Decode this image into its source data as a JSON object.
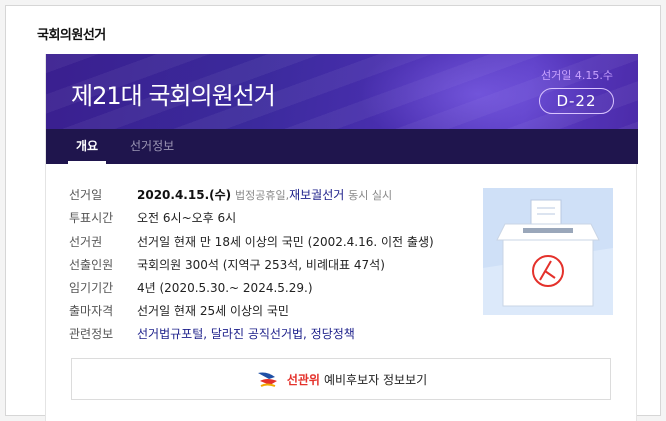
{
  "section_title": "국회의원선거",
  "banner": {
    "title": "제21대 국회의원선거",
    "election_date": "선거일 4.15.수",
    "dday": "D-22"
  },
  "tabs": [
    {
      "label": "개요",
      "active": true
    },
    {
      "label": "선거정보",
      "active": false
    }
  ],
  "info": {
    "election_day": {
      "label": "선거일",
      "date": "2020.4.15.(수)",
      "holiday": "법정공휴일,",
      "also": "재보궐선거",
      "suffix": "동시 실시"
    },
    "voting_hours": {
      "label": "투표시간",
      "value": "오전 6시~오후 6시"
    },
    "suffrage": {
      "label": "선거권",
      "value": "선거일 현재 만 18세 이상의 국민 (2002.4.16. 이전 출생)"
    },
    "seats": {
      "label": "선출인원",
      "value": "국회의원 300석 (지역구 253석, 비례대표 47석)"
    },
    "term": {
      "label": "임기기간",
      "value": "4년 (2020.5.30.~ 2024.5.29.)"
    },
    "eligibility": {
      "label": "출마자격",
      "value": "선거일 현재 25세 이상의 국민"
    },
    "related": {
      "label": "관련정보",
      "links": [
        "선거법규포털,",
        "달라진 공직선거법,",
        "정당정책"
      ]
    }
  },
  "button": {
    "brand": "선관위",
    "label": "예비후보자 정보보기"
  },
  "colors": {
    "banner_purple": "#3b2a9c",
    "tab_bar": "#1f154d",
    "accent_red": "#e4312b",
    "date_lilac": "#c9a3ff"
  }
}
